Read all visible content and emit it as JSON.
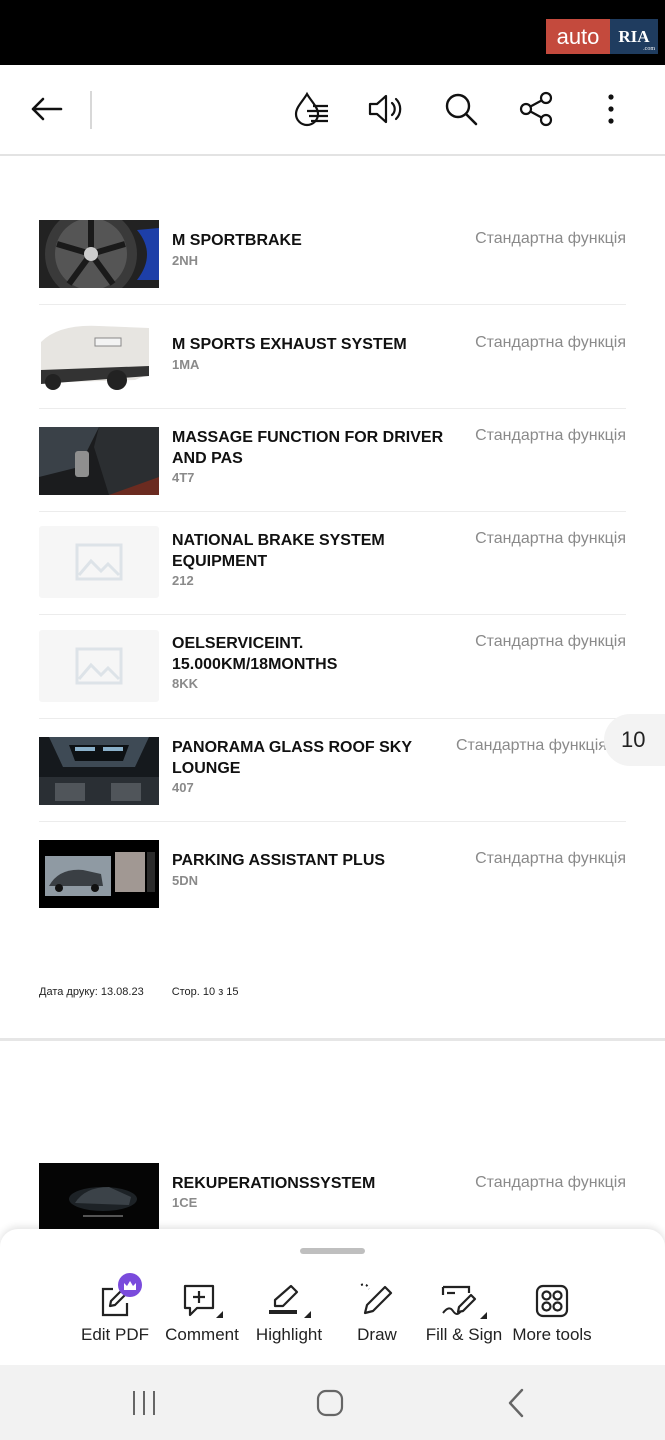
{
  "watermark": {
    "left": "auto",
    "right": "RIA",
    "small": ".com"
  },
  "page1": {
    "items": [
      {
        "name": "M SPORTBRAKE",
        "code": "2NH",
        "status": "Стандартна функція"
      },
      {
        "name": "M SPORTS EXHAUST SYSTEM",
        "code": "1MA",
        "status": "Стандартна функція"
      },
      {
        "name": "MASSAGE FUNCTION FOR DRIVER AND PAS",
        "code": "4T7",
        "status": "Стандартна функція"
      },
      {
        "name": "NATIONAL BRAKE SYSTEM EQUIPMENT",
        "code": "212",
        "status": "Стандартна функція"
      },
      {
        "name": "OELSERVICEINT. 15.000KM/18MONTHS",
        "code": "8KK",
        "status": "Стандартна функція"
      },
      {
        "name": "PANORAMA GLASS ROOF SKY LOUNGE",
        "code": "407",
        "status": "Стандартна функція"
      },
      {
        "name": "PARKING ASSISTANT PLUS",
        "code": "5DN",
        "status": "Стандартна функція"
      }
    ],
    "footer": {
      "print_date": "Дата друку: 13.08.23",
      "page_of": "Стор. 10 з 15"
    }
  },
  "page2": {
    "items": [
      {
        "name": "REKUPERATIONSSYSTEM",
        "code": "1CE",
        "status": "Стандартна функція"
      }
    ]
  },
  "page_indicator": "10",
  "tools": [
    {
      "label": "Edit PDF",
      "icon": "edit-pdf-icon"
    },
    {
      "label": "Comment",
      "icon": "comment-icon"
    },
    {
      "label": "Highlight",
      "icon": "highlight-icon"
    },
    {
      "label": "Draw",
      "icon": "draw-icon"
    },
    {
      "label": "Fill & Sign",
      "icon": "fill-sign-icon"
    },
    {
      "label": "More tools",
      "icon": "more-tools-icon"
    }
  ],
  "colors": {
    "crown": "#7a4bdc",
    "status_text": "#8a8a8a",
    "watermark_red": "#c44a3d",
    "watermark_blue": "#1f3c5f"
  }
}
